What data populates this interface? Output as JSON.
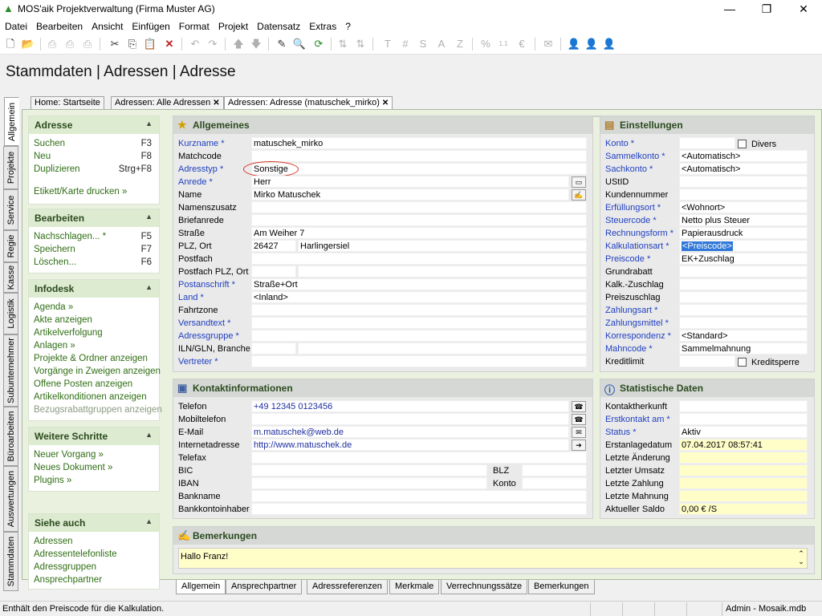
{
  "window": {
    "title": "MOS'aik Projektverwaltung (Firma Muster AG)",
    "minimize": "—",
    "maximize": "❐",
    "close": "✕"
  },
  "menu": [
    "Datei",
    "Bearbeiten",
    "Ansicht",
    "Einfügen",
    "Format",
    "Projekt",
    "Datensatz",
    "Extras",
    "?"
  ],
  "page_title": "Stammdaten | Adressen | Adresse",
  "vertical_tabs": [
    "Allgemein",
    "Projekte",
    "Service",
    "Regie",
    "Kasse",
    "Logistik",
    "Subunternehmer",
    "Büroarbeiten",
    "Auswertungen",
    "Stammdaten"
  ],
  "doc_tabs": [
    "Home: Startseite",
    "Adressen: Alle Adressen",
    "Adressen: Adresse (matuschek_mirko)"
  ],
  "sidebar": {
    "adresse": {
      "title": "Adresse",
      "items": [
        {
          "label": "Suchen",
          "key": "F3"
        },
        {
          "label": "Neu",
          "key": "F8"
        },
        {
          "label": "Duplizieren",
          "key": "Strg+F8"
        }
      ],
      "extra": "Etikett/Karte drucken »"
    },
    "bearbeiten": {
      "title": "Bearbeiten",
      "items": [
        {
          "label": "Nachschlagen... *",
          "key": "F5"
        },
        {
          "label": "Speichern",
          "key": "F7"
        },
        {
          "label": "Löschen...",
          "key": "F6"
        }
      ]
    },
    "infodesk": {
      "title": "Infodesk",
      "items": [
        "Agenda »",
        "Akte anzeigen",
        "Artikelverfolgung",
        "Anlagen »",
        "Projekte & Ordner anzeigen",
        "Vorgänge in Zweigen anzeigen",
        "Offene Posten anzeigen",
        "Artikelkonditionen anzeigen",
        "Bezugsrabattgruppen anzeigen"
      ]
    },
    "weitere": {
      "title": "Weitere Schritte",
      "items": [
        "Neuer Vorgang »",
        "Neues Dokument »",
        "Plugins »"
      ]
    },
    "siehe": {
      "title": "Siehe auch",
      "items": [
        "Adressen",
        "Adressentelefonliste",
        "Adressgruppen",
        "Ansprechpartner"
      ]
    }
  },
  "allgemeines": {
    "title": "Allgemeines",
    "kurzname": {
      "label": "Kurzname *",
      "value": "matuschek_mirko"
    },
    "matchcode": {
      "label": "Matchcode",
      "value": ""
    },
    "adresstyp": {
      "label": "Adresstyp *",
      "value": "Sonstige"
    },
    "anrede": {
      "label": "Anrede *",
      "value": "Herr"
    },
    "name": {
      "label": "Name",
      "value": "Mirko Matuschek"
    },
    "namenszusatz": {
      "label": "Namenszusatz",
      "value": ""
    },
    "briefanrede": {
      "label": "Briefanrede",
      "value": ""
    },
    "strasse": {
      "label": "Straße",
      "value": "Am Weiher 7"
    },
    "plz_ort": {
      "label": "PLZ, Ort",
      "plz": "26427",
      "ort": "Harlingersiel"
    },
    "postfach": {
      "label": "Postfach",
      "value": ""
    },
    "postfach_plz": {
      "label": "Postfach PLZ, Ort",
      "value": ""
    },
    "postanschrift": {
      "label": "Postanschrift *",
      "value": "Straße+Ort"
    },
    "land": {
      "label": "Land *",
      "value": "<Inland>"
    },
    "fahrtzone": {
      "label": "Fahrtzone",
      "value": ""
    },
    "versandtext": {
      "label": "Versandtext *",
      "value": ""
    },
    "adressgruppe": {
      "label": "Adressgruppe *",
      "value": ""
    },
    "iln": {
      "label": "ILN/GLN, Branche",
      "value": ""
    },
    "vertreter": {
      "label": "Vertreter *",
      "value": ""
    }
  },
  "einstellungen": {
    "title": "Einstellungen",
    "rows": [
      {
        "label": "Konto *",
        "value": "",
        "req": true
      },
      {
        "label": "Sammelkonto *",
        "value": "<Automatisch>",
        "req": true
      },
      {
        "label": "Sachkonto *",
        "value": "<Automatisch>",
        "req": true
      },
      {
        "label": "UStID",
        "value": "",
        "req": false
      },
      {
        "label": "Kundennummer",
        "value": "",
        "req": false
      },
      {
        "label": "Erfüllungsort *",
        "value": "<Wohnort>",
        "req": true
      },
      {
        "label": "Steuercode *",
        "value": "Netto plus Steuer",
        "req": true
      },
      {
        "label": "Rechnungsform *",
        "value": "Papierausdruck",
        "req": true
      },
      {
        "label": "Kalkulationsart *",
        "value": "<Preiscode>",
        "req": true
      },
      {
        "label": "Preiscode *",
        "value": "EK+Zuschlag",
        "req": true
      },
      {
        "label": "Grundrabatt",
        "value": "",
        "req": false
      },
      {
        "label": "Kalk.-Zuschlag",
        "value": "",
        "req": false
      },
      {
        "label": "Preiszuschlag",
        "value": "",
        "req": false
      },
      {
        "label": "Zahlungsart *",
        "value": "",
        "req": true
      },
      {
        "label": "Zahlungsmittel *",
        "value": "",
        "req": true
      },
      {
        "label": "Korrespondenz *",
        "value": "<Standard>",
        "req": true
      },
      {
        "label": "Mahncode *",
        "value": "Sammelmahnung",
        "req": true
      },
      {
        "label": "Kreditlimit",
        "value": "",
        "req": false
      }
    ],
    "divers": "Divers",
    "kreditsperre": "Kreditsperre"
  },
  "kontakt": {
    "title": "Kontaktinformationen",
    "telefon": {
      "label": "Telefon",
      "value": "+49 12345 0123456"
    },
    "mobil": {
      "label": "Mobiltelefon",
      "value": ""
    },
    "email": {
      "label": "E-Mail",
      "value": "m.matuschek@web.de"
    },
    "internet": {
      "label": "Internetadresse",
      "value": "http://www.matuschek.de"
    },
    "telefax": {
      "label": "Telefax",
      "value": ""
    },
    "bic": {
      "label": "BIC",
      "value": ""
    },
    "blz": {
      "label": "BLZ",
      "value": ""
    },
    "iban": {
      "label": "IBAN",
      "value": ""
    },
    "konto": {
      "label": "Konto",
      "value": ""
    },
    "bankname": {
      "label": "Bankname",
      "value": ""
    },
    "inhaber": {
      "label": "Bankkontoinhaber",
      "value": ""
    }
  },
  "statistik": {
    "title": "Statistische Daten",
    "rows": [
      {
        "label": "Kontaktherkunft",
        "value": "",
        "req": false,
        "yel": false
      },
      {
        "label": "Erstkontakt am *",
        "value": "",
        "req": true,
        "yel": false
      },
      {
        "label": "Status *",
        "value": "Aktiv",
        "req": true,
        "yel": false
      },
      {
        "label": "Erstanlagedatum",
        "value": "07.04.2017 08:57:41",
        "req": false,
        "yel": true
      },
      {
        "label": "Letzte Änderung",
        "value": "",
        "req": false,
        "yel": true
      },
      {
        "label": "Letzter Umsatz",
        "value": "",
        "req": false,
        "yel": true
      },
      {
        "label": "Letzte Zahlung",
        "value": "",
        "req": false,
        "yel": true
      },
      {
        "label": "Letzte Mahnung",
        "value": "",
        "req": false,
        "yel": true
      },
      {
        "label": "Aktueller Saldo",
        "value": "0,00 € /S",
        "req": false,
        "yel": true
      }
    ]
  },
  "bemerkungen": {
    "title": "Bemerkungen",
    "value": "Hallo Franz!"
  },
  "bottom_tabs": [
    "Allgemein",
    "Ansprechpartner",
    "Adressreferenzen",
    "Merkmale",
    "Verrechnungssätze",
    "Bemerkungen"
  ],
  "status": {
    "message": "Enthält den Preiscode für die Kalkulation.",
    "user": "Admin - Mosaik.mdb"
  }
}
